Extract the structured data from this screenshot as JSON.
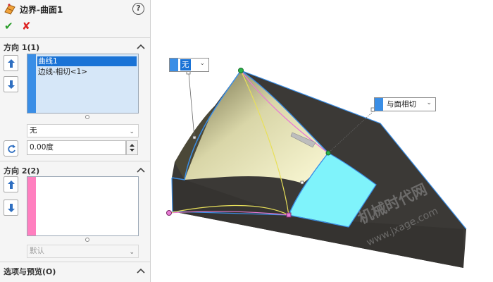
{
  "feature": {
    "title": "边界-曲面1",
    "help_label": "?",
    "ok_glyph": "✔",
    "cancel_glyph": "✘"
  },
  "direction1": {
    "title": "方向 1(1)",
    "items": [
      "曲线1",
      "边线-相切<1>"
    ],
    "selected_index": 0,
    "strip_color": "#3a8ee6",
    "tangency": "无",
    "angle": "0.00度"
  },
  "direction2": {
    "title": "方向 2(2)",
    "strip_color": "#ff7fbf",
    "tangency": "默认"
  },
  "options": {
    "title": "选项与预览(O)"
  },
  "viewport": {
    "callout1": "无",
    "callout2": "与面相切",
    "watermark1": "机械时代网",
    "watermark2": "www.jxage.com",
    "surface_color": "#f7f4c8",
    "tangent_face_color": "#7ff3fb",
    "body_color": "#3e3c3a"
  },
  "icons": [
    "boundary-surface-icon",
    "help-icon",
    "ok-icon",
    "cancel-icon",
    "up-arrow-icon",
    "down-arrow-icon",
    "reverse-direction-icon",
    "chevron-up-icon",
    "dropdown-arrow-icon"
  ]
}
